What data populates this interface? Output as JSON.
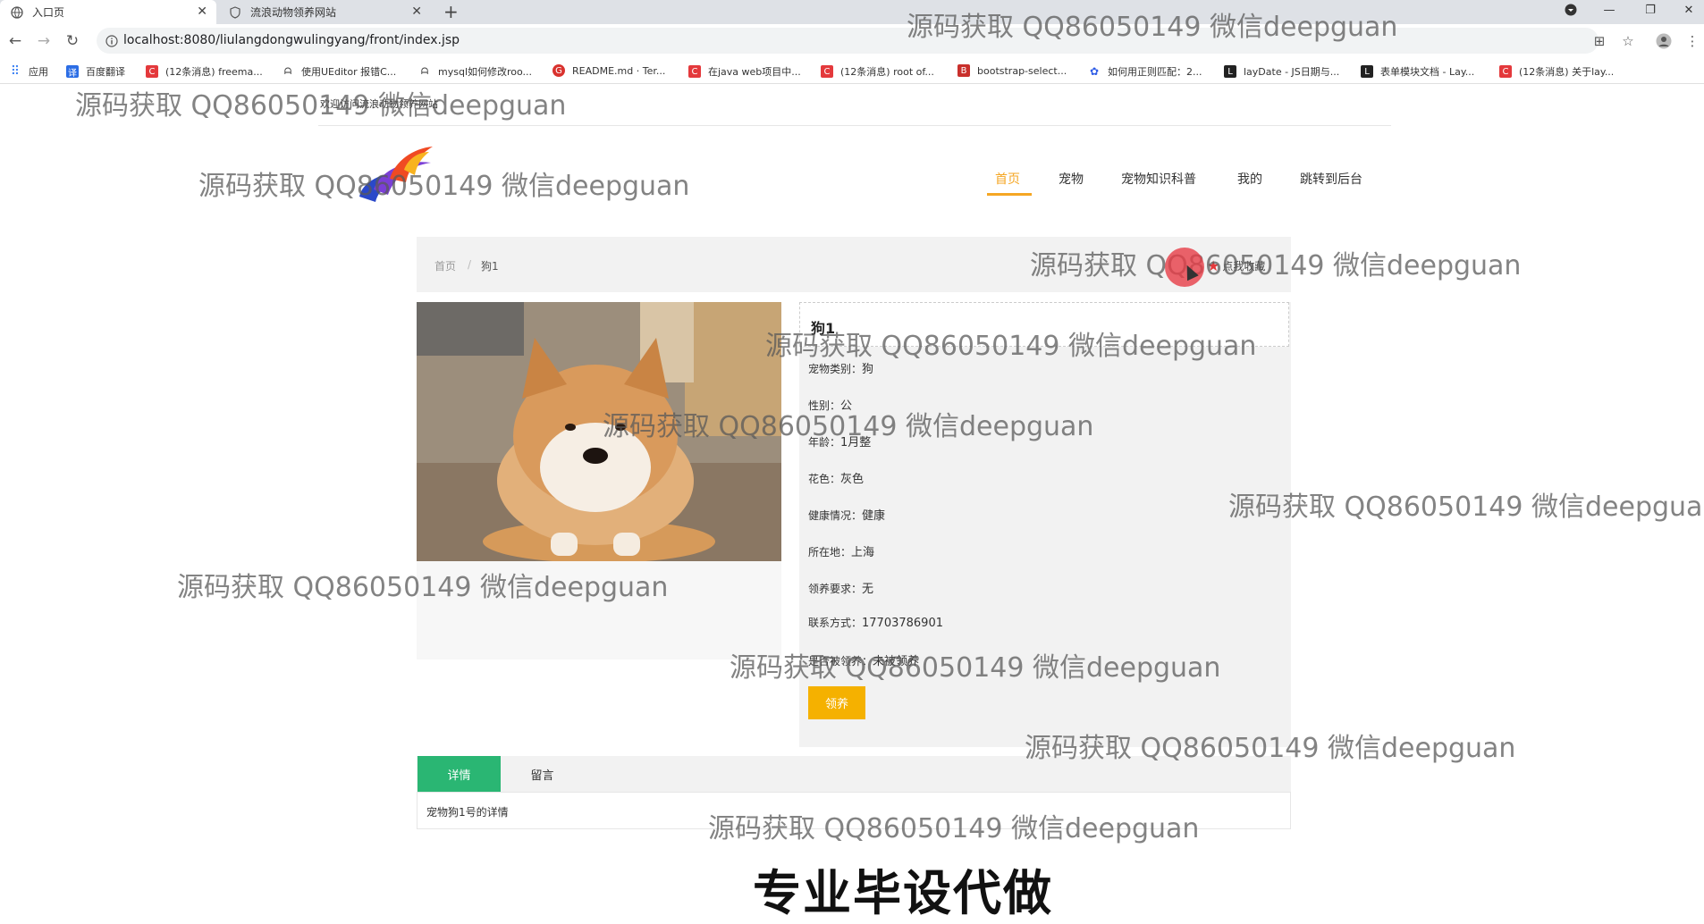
{
  "browser": {
    "tabs": [
      {
        "title": "入口页",
        "active": true
      },
      {
        "title": "流浪动物领养网站",
        "active": false
      }
    ],
    "url": "localhost:8080/liulangdongwulingyang/front/index.jsp",
    "bookmarks": [
      {
        "label": "应用",
        "color": "#4285f4"
      },
      {
        "label": "百度翻译",
        "color": "#2b6de5"
      },
      {
        "label": "(12条消息) freema...",
        "color": "#e4393c"
      },
      {
        "label": "使用UEditor 报错C...",
        "color": "#333333"
      },
      {
        "label": "mysql如何修改roo...",
        "color": "#333333"
      },
      {
        "label": "README.md · Ter...",
        "color": "#d9322e"
      },
      {
        "label": "在java web项目中...",
        "color": "#e4393c"
      },
      {
        "label": "(12条消息) root of...",
        "color": "#e4393c"
      },
      {
        "label": "bootstrap-select...",
        "color": "#c9302c"
      },
      {
        "label": "如何用正则匹配：2...",
        "color": "#2e5ce6"
      },
      {
        "label": "layDate - JS日期与...",
        "color": "#222222"
      },
      {
        "label": "表单模块文档 - Lay...",
        "color": "#222222"
      },
      {
        "label": "(12条消息) 关于lay...",
        "color": "#e4393c"
      }
    ]
  },
  "header": {
    "welcome": "欢迎访问流浪动物领养网站",
    "nav": [
      "首页",
      "宠物",
      "宠物知识科普",
      "我的",
      "跳转到后台"
    ]
  },
  "breadcrumb": {
    "home": "首页",
    "sep": "/",
    "current": "狗1"
  },
  "favorite": {
    "label": "点我收藏"
  },
  "pet": {
    "name": "狗1",
    "fields": [
      {
        "label": "宠物类别：",
        "value": "狗"
      },
      {
        "label": "性别：",
        "value": "公"
      },
      {
        "label": "年龄：",
        "value": "1月整"
      },
      {
        "label": "花色：",
        "value": "灰色"
      },
      {
        "label": "健康情况：",
        "value": "健康"
      },
      {
        "label": "所在地：",
        "value": "上海"
      },
      {
        "label": "领养要求：",
        "value": "无"
      },
      {
        "label": "联系方式：",
        "value": "17703786901"
      },
      {
        "label": "是否被领养：",
        "value": "未被领养"
      }
    ],
    "adopt_label": "领养"
  },
  "detail_tabs": [
    "详情",
    "留言"
  ],
  "detail_text": "宠物狗1号的详情",
  "banner": "专业毕设代做",
  "watermark": "源码获取 QQ86050149 微信deepguan",
  "colors": {
    "accent": "#f5a623",
    "green": "#2ab673",
    "adopt": "#f5b100",
    "star": "#e4393c"
  }
}
